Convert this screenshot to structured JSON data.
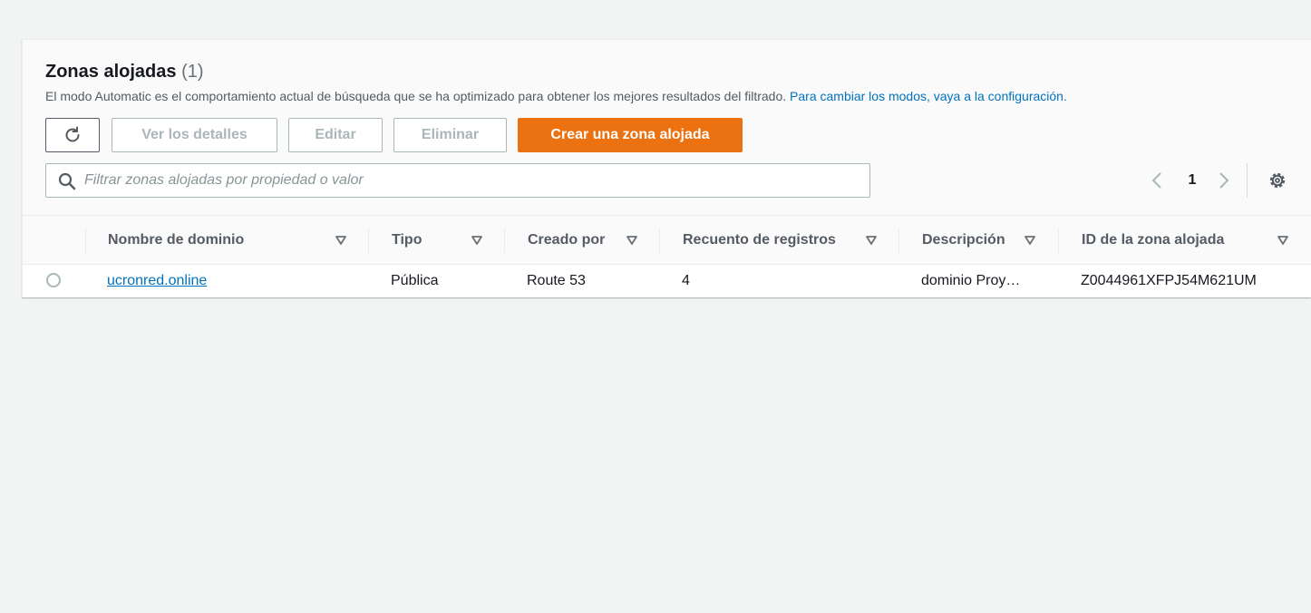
{
  "header": {
    "title": "Zonas alojadas",
    "count": "(1)",
    "description": "El modo Automatic es el comportamiento actual de búsqueda que se ha optimizado para obtener los mejores resultados del filtrado.",
    "config_link": "Para cambiar los modos, vaya a la configuración."
  },
  "toolbar": {
    "refresh_icon": "refresh-icon",
    "details_label": "Ver los detalles",
    "edit_label": "Editar",
    "delete_label": "Eliminar",
    "create_label": "Crear una zona alojada"
  },
  "search": {
    "placeholder": "Filtrar zonas alojadas por propiedad o valor",
    "icon": "search-icon"
  },
  "pagination": {
    "current_page": "1",
    "prev_icon": "chevron-left-icon",
    "next_icon": "chevron-right-icon",
    "settings_icon": "gear-icon"
  },
  "table": {
    "columns": [
      "Nombre de dominio",
      "Tipo",
      "Creado por",
      "Recuento de registros",
      "Descripción",
      "ID de la zona alojada"
    ],
    "rows": [
      {
        "domain": "ucronred.online",
        "type": "Pública",
        "created_by": "Route 53",
        "record_count": "4",
        "description": "dominio Proy…",
        "zone_id": "Z0044961XFPJ54M621UM"
      }
    ]
  },
  "colors": {
    "primary": "#ec7211",
    "link": "#0073bb",
    "background": "#f2f3f3"
  }
}
